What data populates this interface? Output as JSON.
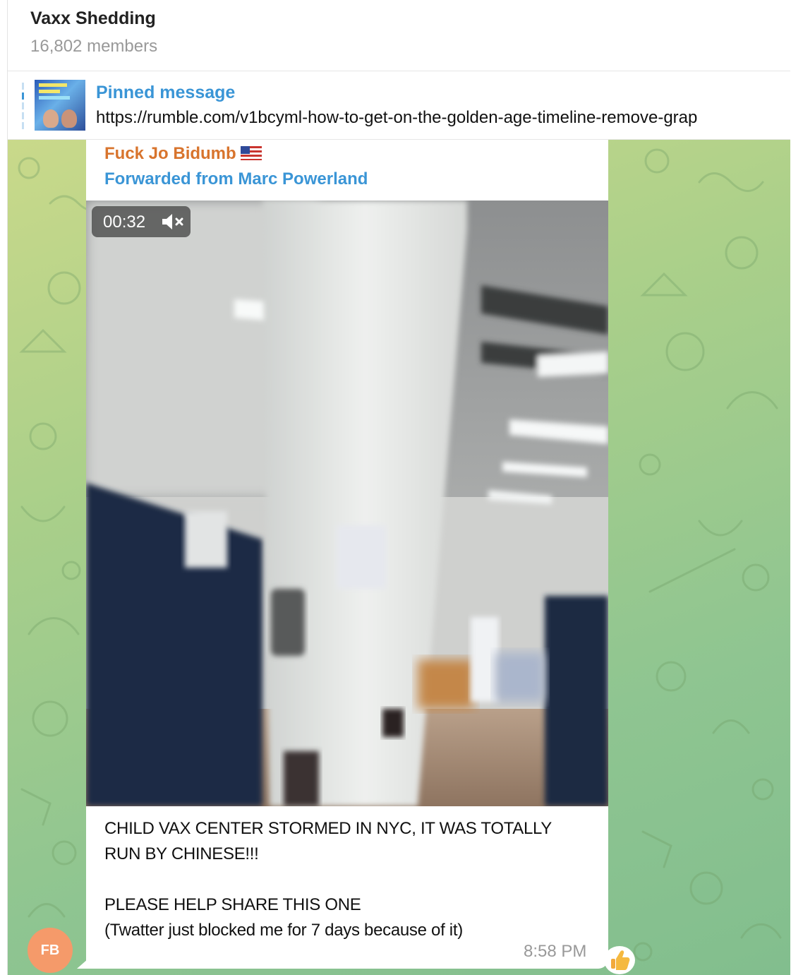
{
  "header": {
    "title": "Vaxx Shedding",
    "members": "16,802 members"
  },
  "pinned": {
    "label": "Pinned message",
    "url": "https://rumble.com/v1bcyml-how-to-get-on-the-golden-age-timeline-remove-grap"
  },
  "message": {
    "sender": "Fuck Jo Bidumb",
    "forwarded_from": "Forwarded from Marc Powerland",
    "video": {
      "duration": "00:32",
      "muted": true
    },
    "caption_lines": [
      "CHILD VAX CENTER STORMED IN NYC, IT WAS TOTALLY",
      "RUN BY CHINESE!!!",
      "PLEASE HELP SHARE THIS ONE",
      "(Twatter just blocked me for 7 days because of it)"
    ],
    "time": "8:58 PM",
    "avatar_initials": "FB",
    "reaction": "thumbs-up"
  },
  "colors": {
    "sender_name": "#d8742d",
    "link_blue": "#3a95d6",
    "avatar": "#f59a6a",
    "wallpaper_start": "#c9d98a",
    "wallpaper_end": "#82be8e"
  }
}
